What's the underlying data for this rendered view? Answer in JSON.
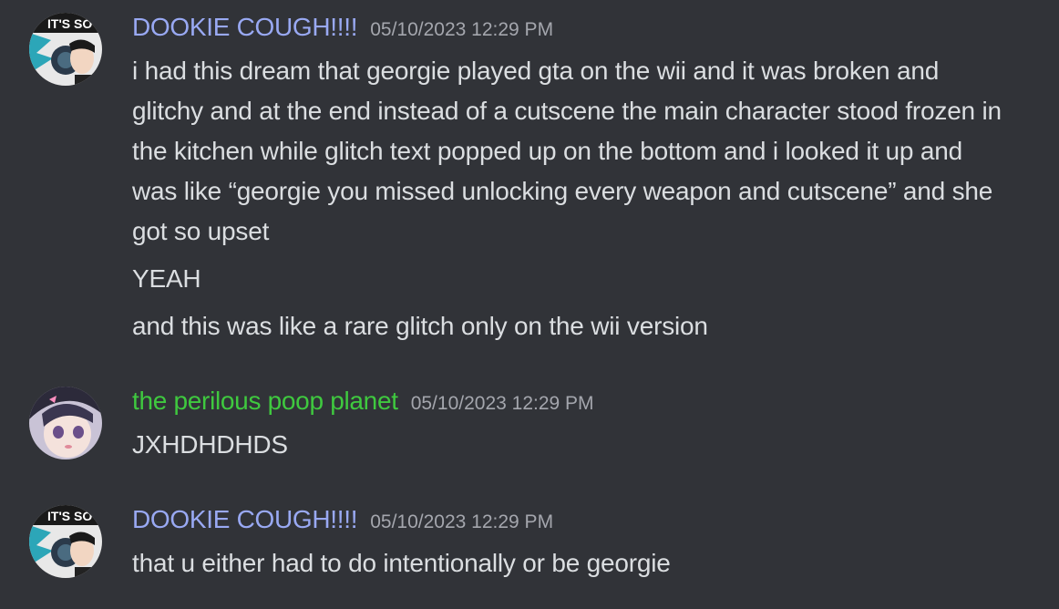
{
  "colors": {
    "background": "#313338",
    "text": "#dbdee1",
    "timestamp": "#a4a6ad",
    "username_blue": "#99a9f3",
    "username_green": "#3fc93f"
  },
  "messages": [
    {
      "username": "DOOKIE COUGH!!!!",
      "username_color": "#99a9f3",
      "avatar_text": "IT'S SO",
      "timestamp": "05/10/2023 12:29 PM",
      "lines": [
        "i had this dream that georgie played gta on the wii and it was broken and glitchy and at the end instead of a cutscene the main character stood frozen in the kitchen while glitch text popped up on the bottom and i looked it up and was like “georgie you missed unlocking every weapon and cutscene” and she got so upset",
        "YEAH",
        "and this was like a rare glitch only on the wii version"
      ]
    },
    {
      "username": "the perilous poop planet",
      "username_color": "#3fc93f",
      "timestamp": "05/10/2023 12:29 PM",
      "lines": [
        "JXHDHDHDS"
      ]
    },
    {
      "username": "DOOKIE COUGH!!!!",
      "username_color": "#99a9f3",
      "avatar_text": "IT'S SO",
      "timestamp": "05/10/2023 12:29 PM",
      "lines": [
        "that u either had to do intentionally or be georgie"
      ]
    }
  ]
}
